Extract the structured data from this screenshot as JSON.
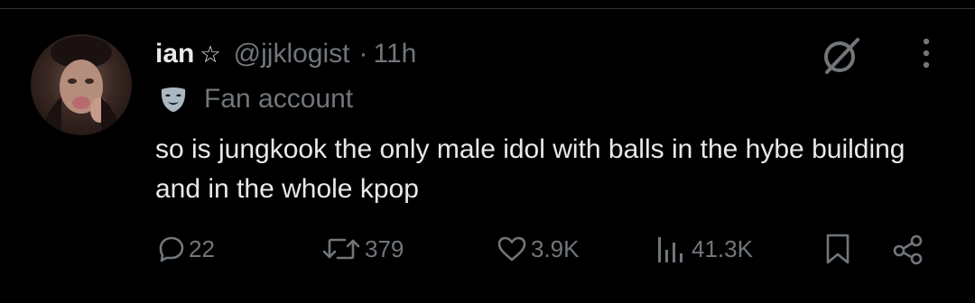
{
  "tweet": {
    "author_name": "ian",
    "author_handle": "@jjklogist",
    "separator": "·",
    "time": "11h",
    "label": "Fan account",
    "text": "so is jungkook the only male idol with balls in the hybe building and in the whole kpop"
  },
  "actions": {
    "replies": "22",
    "reposts": "379",
    "likes": "3.9K",
    "views": "41.3K"
  },
  "icons": {
    "star": "☆",
    "grok": "grok-icon",
    "more": "more-icon",
    "mask": "mask-icon",
    "reply": "reply-icon",
    "repost": "repost-icon",
    "like": "heart-icon",
    "views": "views-icon",
    "bookmark": "bookmark-icon",
    "share": "share-icon"
  },
  "colors": {
    "background": "#000000",
    "text": "#e7e9ea",
    "muted": "#71767b",
    "label_icon": "#aab8c2"
  }
}
